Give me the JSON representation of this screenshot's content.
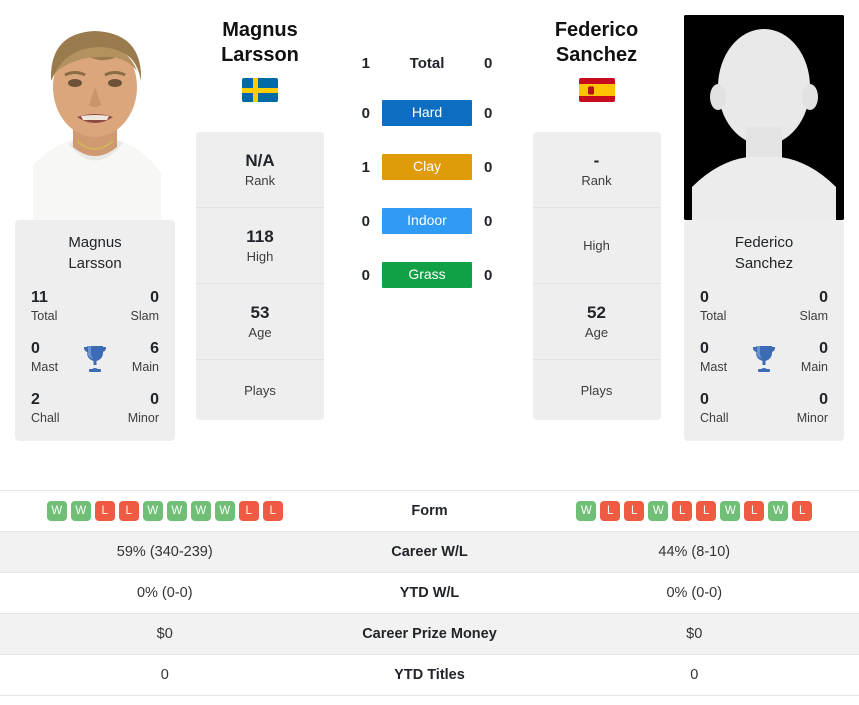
{
  "players": {
    "left": {
      "first_name": "Magnus",
      "last_name": "Larsson",
      "full_name_line1": "Magnus",
      "full_name_line2": "Larsson",
      "country": "Sweden",
      "flag_icon": "flag-sweden-icon",
      "photo_type": "player-photo",
      "titles": {
        "total": "11",
        "total_label": "Total",
        "slam": "0",
        "slam_label": "Slam",
        "mast": "0",
        "mast_label": "Mast",
        "main": "6",
        "main_label": "Main",
        "chall": "2",
        "chall_label": "Chall",
        "minor": "0",
        "minor_label": "Minor"
      },
      "profile": {
        "rank_value": "N/A",
        "rank_label": "Rank",
        "high_value": "118",
        "high_label": "High",
        "age_value": "53",
        "age_label": "Age",
        "plays_value": "",
        "plays_label": "Plays"
      },
      "form": [
        "W",
        "W",
        "L",
        "L",
        "W",
        "W",
        "W",
        "W",
        "L",
        "L"
      ],
      "career_wl": "59% (340-239)",
      "ytd_wl": "0% (0-0)",
      "career_prize_money": "$0",
      "ytd_titles": "0"
    },
    "right": {
      "first_name": "Federico",
      "last_name": "Sanchez",
      "full_name_line1": "Federico",
      "full_name_line2": "Sanchez",
      "country": "Spain",
      "flag_icon": "flag-spain-icon",
      "photo_type": "placeholder-silhouette",
      "titles": {
        "total": "0",
        "total_label": "Total",
        "slam": "0",
        "slam_label": "Slam",
        "mast": "0",
        "mast_label": "Mast",
        "main": "0",
        "main_label": "Main",
        "chall": "0",
        "chall_label": "Chall",
        "minor": "0",
        "minor_label": "Minor"
      },
      "profile": {
        "rank_value": "-",
        "rank_label": "Rank",
        "high_value": "",
        "high_label": "High",
        "age_value": "52",
        "age_label": "Age",
        "plays_value": "",
        "plays_label": "Plays"
      },
      "form": [
        "W",
        "L",
        "L",
        "W",
        "L",
        "L",
        "W",
        "L",
        "W",
        "L"
      ],
      "career_wl": "44% (8-10)",
      "ytd_wl": "0% (0-0)",
      "career_prize_money": "$0",
      "ytd_titles": "0"
    }
  },
  "head_to_head": {
    "rows": [
      {
        "left": "1",
        "label": "Total",
        "right": "0",
        "type": "total",
        "color": ""
      },
      {
        "left": "0",
        "label": "Hard",
        "right": "0",
        "type": "surface",
        "color": "#0d6ec1"
      },
      {
        "left": "1",
        "label": "Clay",
        "right": "0",
        "type": "surface",
        "color": "#e09b0b"
      },
      {
        "left": "0",
        "label": "Indoor",
        "right": "0",
        "type": "surface",
        "color": "#2f9bf5"
      },
      {
        "left": "0",
        "label": "Grass",
        "right": "0",
        "type": "surface",
        "color": "#10a045"
      }
    ]
  },
  "comparison_table": {
    "rows": [
      {
        "label": "Form",
        "type": "form"
      },
      {
        "label": "Career W/L",
        "type": "text",
        "key": "career_wl"
      },
      {
        "label": "YTD W/L",
        "type": "text",
        "key": "ytd_wl"
      },
      {
        "label": "Career Prize Money",
        "type": "text",
        "key": "career_prize_money"
      },
      {
        "label": "YTD Titles",
        "type": "text",
        "key": "ytd_titles"
      }
    ]
  },
  "colors": {
    "hard": "#0d6ec1",
    "clay": "#e09b0b",
    "indoor": "#2f9bf5",
    "grass": "#10a045",
    "win": "#6fbf77",
    "loss": "#ef5b42",
    "trophy": "#3b6bb5",
    "card_bg": "#eeeeee"
  }
}
